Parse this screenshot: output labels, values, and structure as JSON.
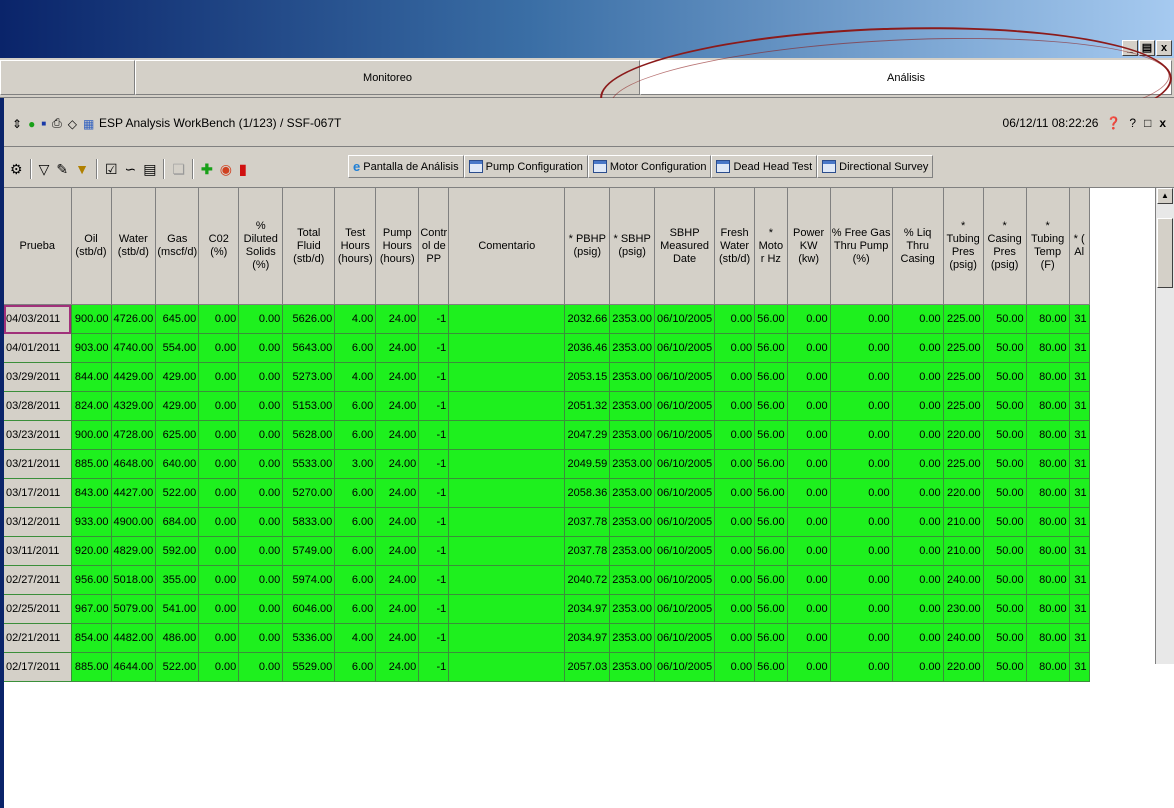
{
  "window": {
    "buttons": [
      "_",
      "И",
      "x"
    ]
  },
  "tabs": [
    {
      "label": ""
    },
    {
      "label": "Monitoreo"
    },
    {
      "label": "Análisis"
    }
  ],
  "header": {
    "title": "ESP Analysis WorkBench (1/123)   / SSF-067T",
    "datetime": "06/12/11 08:22:26",
    "help": "?",
    "restore": "□",
    "close": "x"
  },
  "toolbar": {
    "tabs": [
      {
        "label": "Pantalla de Análisis",
        "icon": "ie-icon"
      },
      {
        "label": "Pump Configuration",
        "icon": "grid-icon"
      },
      {
        "label": "Motor Configuration",
        "icon": "grid-icon"
      },
      {
        "label": "Dead Head Test",
        "icon": "grid-icon"
      },
      {
        "label": "Directional Survey",
        "icon": "grid-icon"
      }
    ]
  },
  "grid": {
    "columns": [
      "Prueba",
      "Oil (stb/d)",
      "Water (stb/d)",
      "Gas (mscf/d)",
      "C02 (%)",
      "% Diluted Solids (%)",
      "Total Fluid (stb/d)",
      "Test Hours (hours)",
      "Pump Hours (hours)",
      "Contr ol de PP",
      "Comentario",
      "* PBHP (psig)",
      "* SBHP (psig)",
      "SBHP Measured Date",
      "Fresh Water (stb/d)",
      "* Moto r Hz",
      "Power KW (kw)",
      "% Free Gas Thru Pump (%)",
      "% Liq Thru Casing",
      "* Tubing Pres (psig)",
      "* Casing Pres (psig)",
      "* Tubing Temp (F)",
      "* ( Al"
    ],
    "rows": [
      [
        "04/03/2011",
        "900.00",
        "4726.00",
        "645.00",
        "0.00",
        "0.00",
        "5626.00",
        "4.00",
        "24.00",
        "-1",
        "",
        "2032.66",
        "2353.00",
        "06/10/2005",
        "0.00",
        "56.00",
        "0.00",
        "0.00",
        "0.00",
        "225.00",
        "50.00",
        "80.00",
        "31"
      ],
      [
        "04/01/2011",
        "903.00",
        "4740.00",
        "554.00",
        "0.00",
        "0.00",
        "5643.00",
        "6.00",
        "24.00",
        "-1",
        "",
        "2036.46",
        "2353.00",
        "06/10/2005",
        "0.00",
        "56.00",
        "0.00",
        "0.00",
        "0.00",
        "225.00",
        "50.00",
        "80.00",
        "31"
      ],
      [
        "03/29/2011",
        "844.00",
        "4429.00",
        "429.00",
        "0.00",
        "0.00",
        "5273.00",
        "4.00",
        "24.00",
        "-1",
        "",
        "2053.15",
        "2353.00",
        "06/10/2005",
        "0.00",
        "56.00",
        "0.00",
        "0.00",
        "0.00",
        "225.00",
        "50.00",
        "80.00",
        "31"
      ],
      [
        "03/28/2011",
        "824.00",
        "4329.00",
        "429.00",
        "0.00",
        "0.00",
        "5153.00",
        "6.00",
        "24.00",
        "-1",
        "",
        "2051.32",
        "2353.00",
        "06/10/2005",
        "0.00",
        "56.00",
        "0.00",
        "0.00",
        "0.00",
        "225.00",
        "50.00",
        "80.00",
        "31"
      ],
      [
        "03/23/2011",
        "900.00",
        "4728.00",
        "625.00",
        "0.00",
        "0.00",
        "5628.00",
        "6.00",
        "24.00",
        "-1",
        "",
        "2047.29",
        "2353.00",
        "06/10/2005",
        "0.00",
        "56.00",
        "0.00",
        "0.00",
        "0.00",
        "220.00",
        "50.00",
        "80.00",
        "31"
      ],
      [
        "03/21/2011",
        "885.00",
        "4648.00",
        "640.00",
        "0.00",
        "0.00",
        "5533.00",
        "3.00",
        "24.00",
        "-1",
        "",
        "2049.59",
        "2353.00",
        "06/10/2005",
        "0.00",
        "56.00",
        "0.00",
        "0.00",
        "0.00",
        "225.00",
        "50.00",
        "80.00",
        "31"
      ],
      [
        "03/17/2011",
        "843.00",
        "4427.00",
        "522.00",
        "0.00",
        "0.00",
        "5270.00",
        "6.00",
        "24.00",
        "-1",
        "",
        "2058.36",
        "2353.00",
        "06/10/2005",
        "0.00",
        "56.00",
        "0.00",
        "0.00",
        "0.00",
        "220.00",
        "50.00",
        "80.00",
        "31"
      ],
      [
        "03/12/2011",
        "933.00",
        "4900.00",
        "684.00",
        "0.00",
        "0.00",
        "5833.00",
        "6.00",
        "24.00",
        "-1",
        "",
        "2037.78",
        "2353.00",
        "06/10/2005",
        "0.00",
        "56.00",
        "0.00",
        "0.00",
        "0.00",
        "210.00",
        "50.00",
        "80.00",
        "31"
      ],
      [
        "03/11/2011",
        "920.00",
        "4829.00",
        "592.00",
        "0.00",
        "0.00",
        "5749.00",
        "6.00",
        "24.00",
        "-1",
        "",
        "2037.78",
        "2353.00",
        "06/10/2005",
        "0.00",
        "56.00",
        "0.00",
        "0.00",
        "0.00",
        "210.00",
        "50.00",
        "80.00",
        "31"
      ],
      [
        "02/27/2011",
        "956.00",
        "5018.00",
        "355.00",
        "0.00",
        "0.00",
        "5974.00",
        "6.00",
        "24.00",
        "-1",
        "",
        "2040.72",
        "2353.00",
        "06/10/2005",
        "0.00",
        "56.00",
        "0.00",
        "0.00",
        "0.00",
        "240.00",
        "50.00",
        "80.00",
        "31"
      ],
      [
        "02/25/2011",
        "967.00",
        "5079.00",
        "541.00",
        "0.00",
        "0.00",
        "6046.00",
        "6.00",
        "24.00",
        "-1",
        "",
        "2034.97",
        "2353.00",
        "06/10/2005",
        "0.00",
        "56.00",
        "0.00",
        "0.00",
        "0.00",
        "230.00",
        "50.00",
        "80.00",
        "31"
      ],
      [
        "02/21/2011",
        "854.00",
        "4482.00",
        "486.00",
        "0.00",
        "0.00",
        "5336.00",
        "4.00",
        "24.00",
        "-1",
        "",
        "2034.97",
        "2353.00",
        "06/10/2005",
        "0.00",
        "56.00",
        "0.00",
        "0.00",
        "0.00",
        "240.00",
        "50.00",
        "80.00",
        "31"
      ],
      [
        "02/17/2011",
        "885.00",
        "4644.00",
        "522.00",
        "0.00",
        "0.00",
        "5529.00",
        "6.00",
        "24.00",
        "-1",
        "",
        "2057.03",
        "2353.00",
        "06/10/2005",
        "0.00",
        "56.00",
        "0.00",
        "0.00",
        "0.00",
        "220.00",
        "50.00",
        "80.00",
        "31"
      ]
    ]
  },
  "colors": {
    "row_green": "#1ef01e",
    "annotation": "#8b1a1a"
  }
}
